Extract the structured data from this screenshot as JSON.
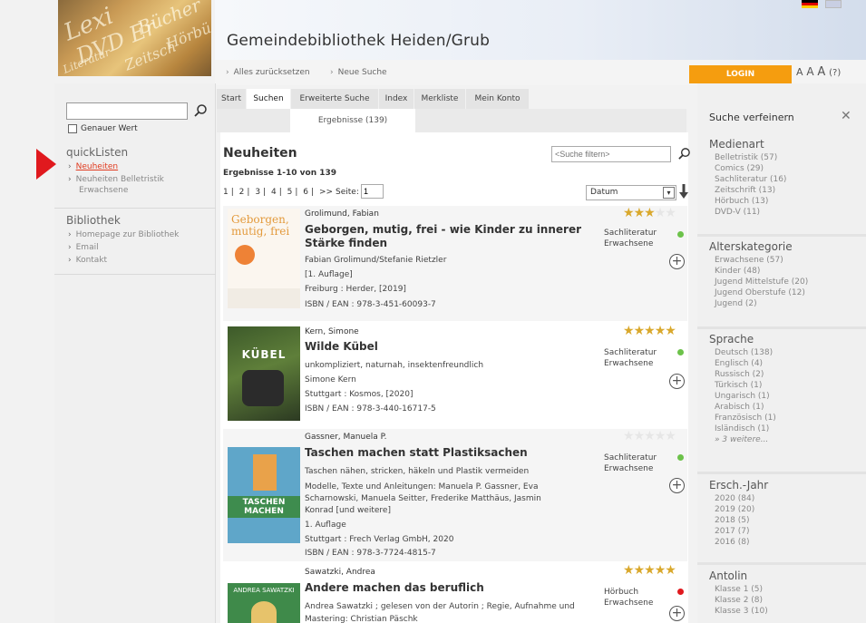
{
  "header": {
    "site_title": "Gemeindebibliothek Heiden/Grub",
    "logo_words": [
      "Lexi",
      "DVD Er",
      "Bücher",
      "Hörbü",
      "Zeitsch",
      "Literatur"
    ],
    "crumbs": [
      "Alles zurücksetzen",
      "Neue Suche"
    ],
    "login_label": "LOGIN",
    "font_size_a": "A",
    "font_size_count": "(?)"
  },
  "left": {
    "search_value": "",
    "exact_label": "Genauer Wert",
    "quicklists_heading": "quickListen",
    "quicklists": [
      "Neuheiten",
      "Neuheiten Belletristik",
      "Erwachsene"
    ],
    "library_heading": "Bibliothek",
    "library_links": [
      "Homepage zur Bibliothek",
      "Email",
      "Kontakt"
    ]
  },
  "tabs": [
    "Start",
    "Suchen",
    "Erweiterte Suche",
    "Index",
    "Merkliste",
    "Mein Konto"
  ],
  "subtab": "Ergebnisse (139)",
  "main": {
    "title": "Neuheiten",
    "filter_placeholder": "<Suche filtern>",
    "results_info": "Ergebnisse 1-10 von 139",
    "pager": [
      "1",
      "|",
      "2",
      "|",
      "3",
      "|",
      "4",
      "|",
      "5",
      "|",
      "6",
      "|",
      ">>",
      "Seite:"
    ],
    "page_value": "1",
    "sort_value": "Datum"
  },
  "results": [
    {
      "author": "Grolimund, Fabian",
      "title": "Geborgen, mutig, frei - wie Kinder zu innerer Stärke finden",
      "lines": [
        "Fabian Grolimund/Stefanie Rietzler",
        "[1. Auflage]",
        "Freiburg : Herder, [2019]",
        "ISBN / EAN : 978-3-451-60093-7"
      ],
      "category": [
        "Sachliteratur",
        "Erwachsene"
      ],
      "rating": 3,
      "available": true,
      "cover_text": "Geborgen, mutig, frei"
    },
    {
      "author": "Kern, Simone",
      "title": "Wilde Kübel",
      "lines": [
        "unkompliziert, naturnah, insektenfreundlich",
        "Simone Kern",
        "Stuttgart : Kosmos, [2020]",
        "ISBN / EAN : 978-3-440-16717-5"
      ],
      "category": [
        "Sachliteratur",
        "Erwachsene"
      ],
      "rating": 5,
      "available": true,
      "cover_text": "KÜBEL"
    },
    {
      "author": "Gassner, Manuela P.",
      "title": "Taschen machen statt Plastiksachen",
      "lines": [
        "Taschen nähen, stricken, häkeln und Plastik vermeiden",
        "Modelle, Texte und Anleitungen: Manuela P. Gassner, Eva",
        "Scharnowski, Manuela Seitter, Frederike Matthäus, Jasmin",
        "Konrad [und weitere]",
        "1. Auflage",
        "Stuttgart : Frech Verlag GmbH, 2020",
        "ISBN / EAN : 978-3-7724-4815-7"
      ],
      "category": [
        "Sachliteratur",
        "Erwachsene"
      ],
      "rating": 0,
      "available": true,
      "cover_text": "TASCHEN MACHEN"
    },
    {
      "author": "Sawatzki, Andrea",
      "title": "Andere machen das beruflich",
      "lines": [
        "Andrea Sawatzki ; gelesen von der Autorin ; Regie, Aufnahme und",
        "Mastering: Christian Päschk"
      ],
      "category": [
        "Hörbuch",
        "Erwachsene"
      ],
      "rating": 5,
      "available": false,
      "cover_text": "ANDREA SAWATZKI"
    }
  ],
  "refine": {
    "title": "Suche verfeinern",
    "close": "✕",
    "facets": [
      {
        "heading": "Medienart",
        "items": [
          "Belletristik (57)",
          "Comics (29)",
          "Sachliteratur (16)",
          "Zeitschrift (13)",
          "Hörbuch (13)",
          "DVD-V (11)"
        ]
      },
      {
        "heading": "Alterskategorie",
        "items": [
          "Erwachsene (57)",
          "Kinder (48)",
          "Jugend Mittelstufe (20)",
          "Jugend Oberstufe (12)",
          "Jugend (2)"
        ]
      },
      {
        "heading": "Sprache",
        "items": [
          "Deutsch (138)",
          "Englisch (4)",
          "Russisch (2)",
          "Türkisch (1)",
          "Ungarisch (1)",
          "Arabisch (1)",
          "Französisch (1)",
          "Isländisch (1)",
          "» 3 weitere..."
        ]
      },
      {
        "heading": "Ersch.-Jahr",
        "items": [
          "2020 (84)",
          "2019 (20)",
          "2018 (5)",
          "2017 (7)",
          "2016 (8)"
        ]
      },
      {
        "heading": "Antolin",
        "items": [
          "Klasse 1 (5)",
          "Klasse 2 (8)",
          "Klasse 3 (10)"
        ]
      }
    ]
  },
  "colors": {
    "accent": "#f59d0f",
    "active_link": "#e03a1e",
    "available": "#6cc24a",
    "unavailable": "#e0191e",
    "star": "#d9a82c"
  }
}
